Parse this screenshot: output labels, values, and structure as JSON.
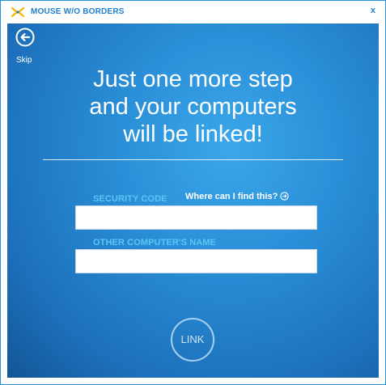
{
  "window": {
    "title": "MOUSE W/O BORDERS",
    "close_label": "x"
  },
  "nav": {
    "skip_label": "Skip",
    "back_icon": "back-arrow-icon"
  },
  "headline": {
    "line1": "Just one more step",
    "line2": "and your computers",
    "line3": "will be linked!"
  },
  "form": {
    "security_code_label": "SECURITY CODE",
    "help_link": "Where can I find this?",
    "security_code_value": "",
    "other_name_label": "OTHER COMPUTER'S NAME",
    "other_name_value": ""
  },
  "actions": {
    "link_label": "LINK"
  },
  "colors": {
    "accent": "#1f7fd0",
    "background_center": "#3ba7ea",
    "background_edge": "#125696",
    "label": "#5cc6f3"
  }
}
